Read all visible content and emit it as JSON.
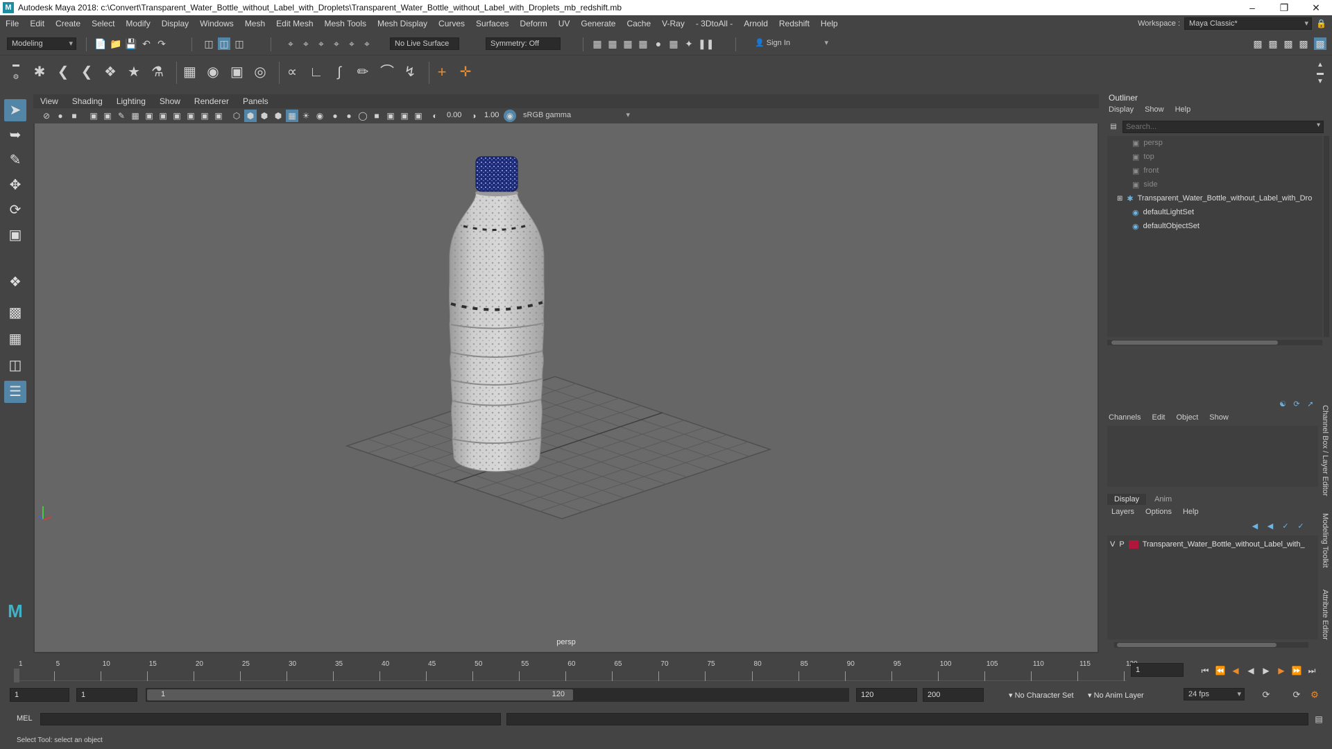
{
  "window": {
    "title": "Autodesk Maya 2018: c:\\Convert\\Transparent_Water_Bottle_without_Label_with_Droplets\\Transparent_Water_Bottle_without_Label_with_Droplets_mb_redshift.mb",
    "logo": "M"
  },
  "menubar": {
    "items": [
      "File",
      "Edit",
      "Create",
      "Select",
      "Modify",
      "Display",
      "Windows",
      "Mesh",
      "Edit Mesh",
      "Mesh Tools",
      "Mesh Display",
      "Curves",
      "Surfaces",
      "Deform",
      "UV",
      "Generate",
      "Cache",
      "V-Ray",
      "- 3DtoAll -",
      "Arnold",
      "Redshift",
      "Help"
    ],
    "workspace_label": "Workspace :",
    "workspace_value": "Maya Classic*"
  },
  "statusline": {
    "mode": "Modeling",
    "live_surface": "No Live Surface",
    "symmetry": "Symmetry: Off",
    "sign_in": "Sign In"
  },
  "viewport": {
    "menus": [
      "View",
      "Shading",
      "Lighting",
      "Show",
      "Renderer",
      "Panels"
    ],
    "exposure": "0.00",
    "gamma": "1.00",
    "color_space": "sRGB gamma",
    "camera_label": "persp"
  },
  "outliner": {
    "title": "Outliner",
    "menus": [
      "Display",
      "Show",
      "Help"
    ],
    "search_placeholder": "Search...",
    "items": [
      {
        "label": "persp",
        "type": "camera",
        "dim": true
      },
      {
        "label": "top",
        "type": "camera",
        "dim": true
      },
      {
        "label": "front",
        "type": "camera",
        "dim": true
      },
      {
        "label": "side",
        "type": "camera",
        "dim": true
      },
      {
        "label": "Transparent_Water_Bottle_without_Label_with_Dro",
        "type": "group",
        "dim": false
      },
      {
        "label": "defaultLightSet",
        "type": "set",
        "dim": false
      },
      {
        "label": "defaultObjectSet",
        "type": "set",
        "dim": false
      }
    ]
  },
  "channelbox": {
    "menus": [
      "Channels",
      "Edit",
      "Object",
      "Show"
    ]
  },
  "layereditor": {
    "tabs": [
      "Display",
      "Anim"
    ],
    "menus": [
      "Layers",
      "Options",
      "Help"
    ],
    "layer": {
      "v": "V",
      "p": "P",
      "name": "Transparent_Water_Bottle_without_Label_with_",
      "color": "#b0173a"
    }
  },
  "side_tabs": [
    "Channel Box / Layer Editor",
    "Modeling Toolkit",
    "Attribute Editor"
  ],
  "timeslider": {
    "ticks": [
      "1",
      "5",
      "10",
      "15",
      "20",
      "25",
      "30",
      "35",
      "40",
      "45",
      "50",
      "55",
      "60",
      "65",
      "70",
      "75",
      "80",
      "85",
      "90",
      "95",
      "100",
      "105",
      "110",
      "115",
      "120"
    ],
    "current_frame": "1"
  },
  "rangeslider": {
    "start": "1",
    "playback_start": "1",
    "range_start_label": "1",
    "range_end_label": "120",
    "playback_end": "120",
    "end": "200",
    "character_set": "No Character Set",
    "anim_layer": "No Anim Layer",
    "fps": "24 fps"
  },
  "cmdline": {
    "label": "MEL"
  },
  "helpline": {
    "text": "Select Tool: select an object"
  }
}
